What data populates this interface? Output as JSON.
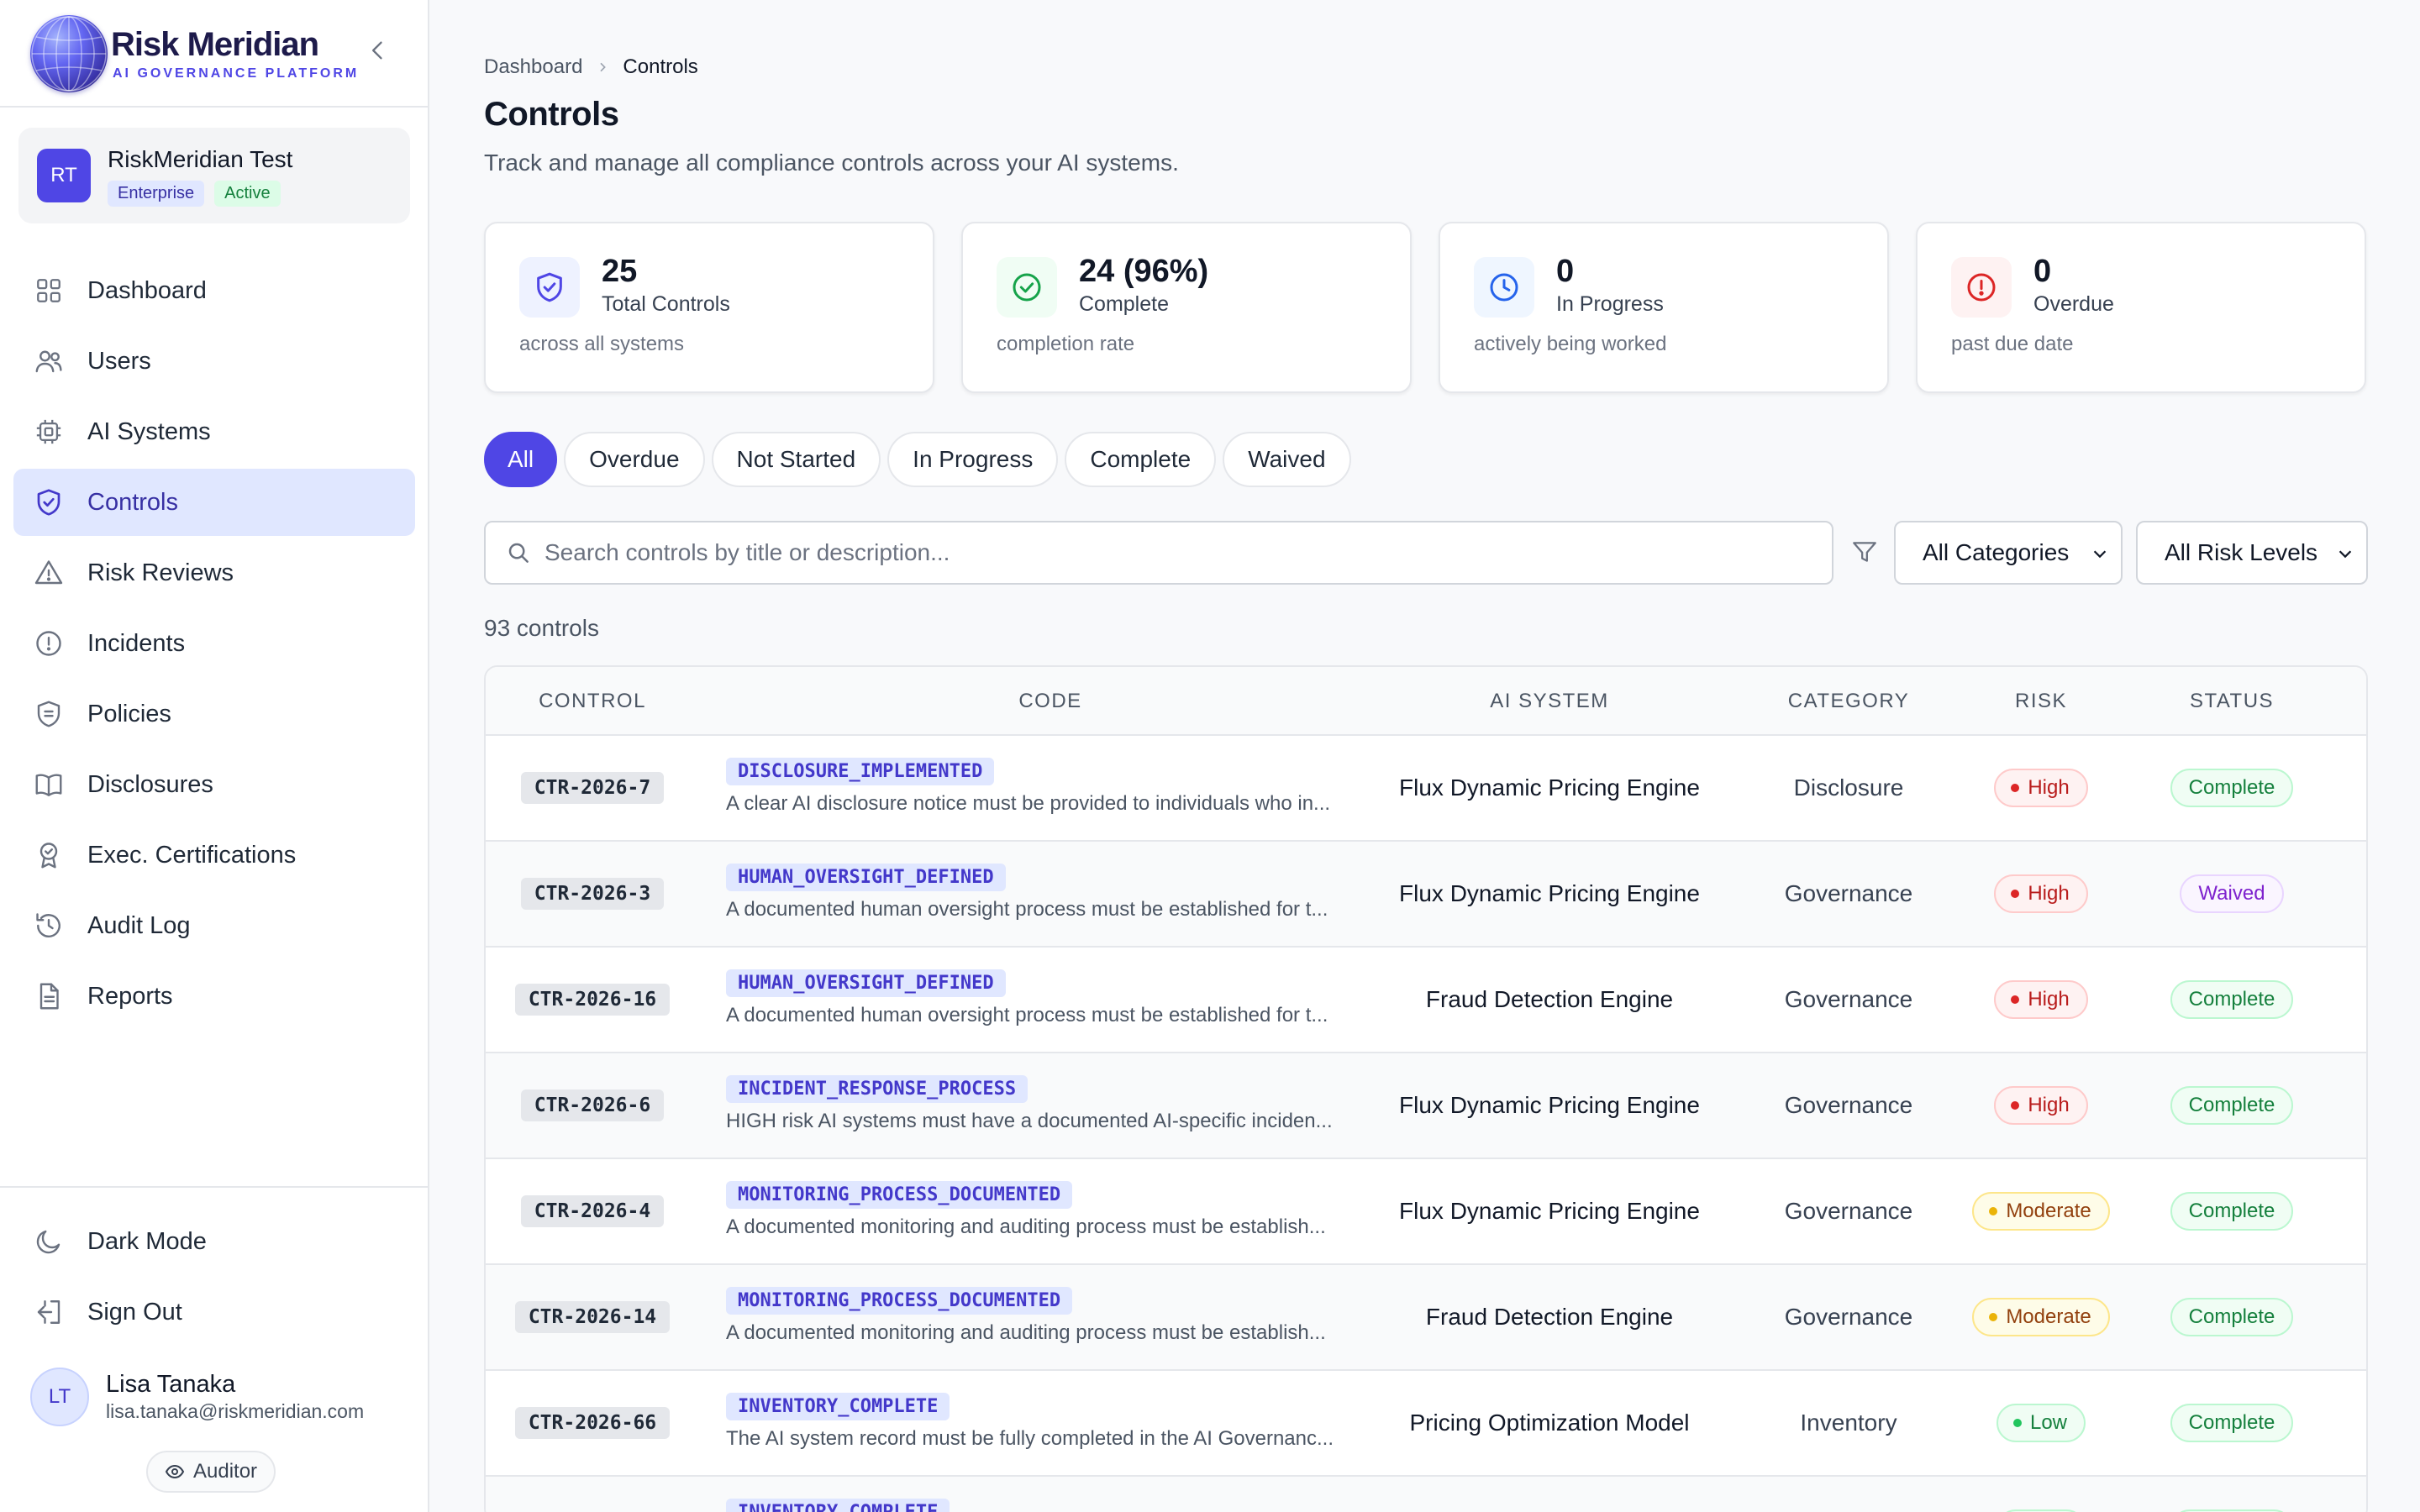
{
  "brand": {
    "name": "Risk Meridian",
    "tagline": "AI GOVERNANCE PLATFORM"
  },
  "org": {
    "initials": "RT",
    "name": "RiskMeridian Test",
    "plan": "Enterprise",
    "state": "Active"
  },
  "nav": [
    {
      "label": "Dashboard",
      "icon": "grid-icon"
    },
    {
      "label": "Users",
      "icon": "users-icon"
    },
    {
      "label": "AI Systems",
      "icon": "cpu-icon"
    },
    {
      "label": "Controls",
      "icon": "shield-check-icon",
      "active": true
    },
    {
      "label": "Risk Reviews",
      "icon": "warning-triangle-icon"
    },
    {
      "label": "Incidents",
      "icon": "alert-circle-icon"
    },
    {
      "label": "Policies",
      "icon": "shield-list-icon"
    },
    {
      "label": "Disclosures",
      "icon": "book-open-icon"
    },
    {
      "label": "Exec. Certifications",
      "icon": "award-icon"
    },
    {
      "label": "Audit Log",
      "icon": "history-icon"
    },
    {
      "label": "Reports",
      "icon": "file-text-icon"
    }
  ],
  "bottom_nav": {
    "dark_mode": "Dark Mode",
    "sign_out": "Sign Out"
  },
  "user": {
    "initials": "LT",
    "name": "Lisa Tanaka",
    "email": "lisa.tanaka@riskmeridian.com",
    "role": "Auditor"
  },
  "breadcrumb": {
    "root": "Dashboard",
    "current": "Controls"
  },
  "page": {
    "title": "Controls",
    "subtitle": "Track and manage all compliance controls across your AI systems."
  },
  "stats": [
    {
      "value": "25",
      "label": "Total Controls",
      "sub": "across all systems",
      "color": "#4f46e5"
    },
    {
      "value": "24 (96%)",
      "label": "Complete",
      "sub": "completion rate",
      "color": "#16a34a"
    },
    {
      "value": "0",
      "label": "In Progress",
      "sub": "actively being worked",
      "color": "#2563eb"
    },
    {
      "value": "0",
      "label": "Overdue",
      "sub": "past due date",
      "color": "#dc2626"
    }
  ],
  "tabs": [
    "All",
    "Overdue",
    "Not Started",
    "In Progress",
    "Complete",
    "Waived"
  ],
  "search": {
    "placeholder": "Search controls by title or description...",
    "value": ""
  },
  "filters": {
    "category": "All Categories",
    "risk": "All Risk Levels"
  },
  "count_text": "93 controls",
  "table": {
    "columns": [
      "CONTROL",
      "CODE",
      "AI SYSTEM",
      "CATEGORY",
      "RISK",
      "STATUS"
    ],
    "rows": [
      {
        "id": "CTR-2026-7",
        "code": "DISCLOSURE_IMPLEMENTED",
        "desc": "A clear AI disclosure notice must be provided to individuals who in...",
        "system": "Flux Dynamic Pricing Engine",
        "category": "Disclosure",
        "risk": "High",
        "status": "Complete"
      },
      {
        "id": "CTR-2026-3",
        "code": "HUMAN_OVERSIGHT_DEFINED",
        "desc": "A documented human oversight process must be established for t...",
        "system": "Flux Dynamic Pricing Engine",
        "category": "Governance",
        "risk": "High",
        "status": "Waived"
      },
      {
        "id": "CTR-2026-16",
        "code": "HUMAN_OVERSIGHT_DEFINED",
        "desc": "A documented human oversight process must be established for t...",
        "system": "Fraud Detection Engine",
        "category": "Governance",
        "risk": "High",
        "status": "Complete"
      },
      {
        "id": "CTR-2026-6",
        "code": "INCIDENT_RESPONSE_PROCESS",
        "desc": "HIGH risk AI systems must have a documented AI-specific inciden...",
        "system": "Flux Dynamic Pricing Engine",
        "category": "Governance",
        "risk": "High",
        "status": "Complete"
      },
      {
        "id": "CTR-2026-4",
        "code": "MONITORING_PROCESS_DOCUMENTED",
        "desc": "A documented monitoring and auditing process must be establish...",
        "system": "Flux Dynamic Pricing Engine",
        "category": "Governance",
        "risk": "Moderate",
        "status": "Complete"
      },
      {
        "id": "CTR-2026-14",
        "code": "MONITORING_PROCESS_DOCUMENTED",
        "desc": "A documented monitoring and auditing process must be establish...",
        "system": "Fraud Detection Engine",
        "category": "Governance",
        "risk": "Moderate",
        "status": "Complete"
      },
      {
        "id": "CTR-2026-66",
        "code": "INVENTORY_COMPLETE",
        "desc": "The AI system record must be fully completed in the AI Governanc...",
        "system": "Pricing Optimization Model",
        "category": "Inventory",
        "risk": "Low",
        "status": "Complete"
      },
      {
        "id": "",
        "code": "INVENTORY_COMPLETE",
        "desc": "",
        "system": "",
        "category": "",
        "risk": "Low",
        "status": "Complete"
      }
    ]
  }
}
